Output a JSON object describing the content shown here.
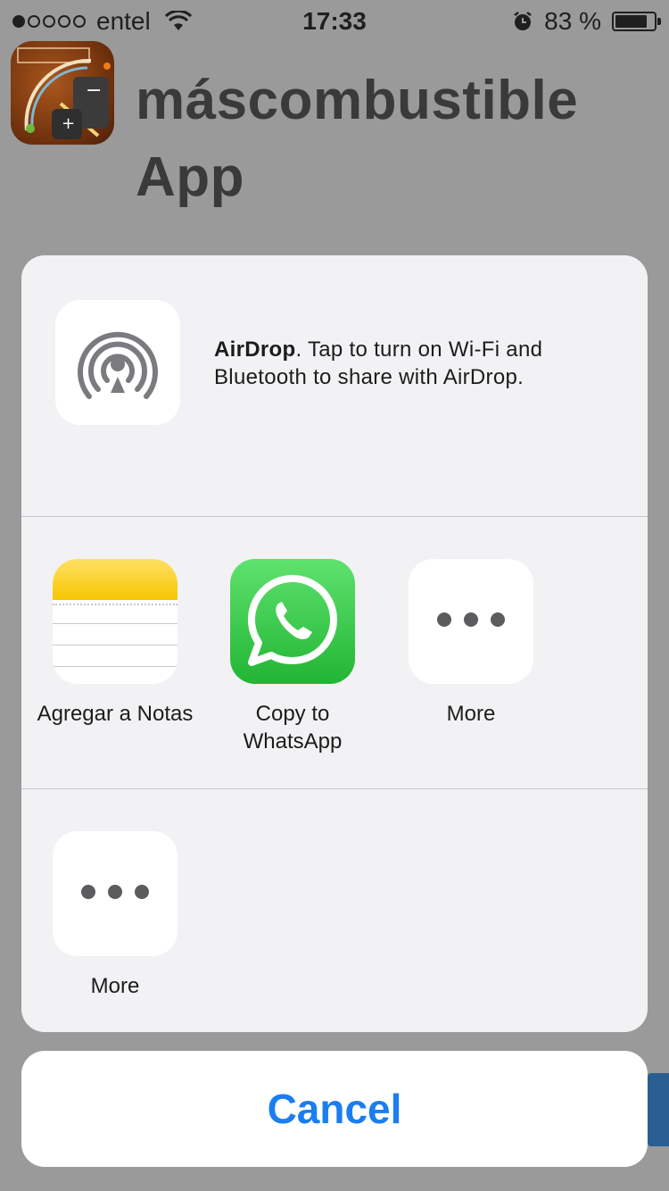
{
  "status_bar": {
    "carrier": "entel",
    "time": "17:33",
    "battery_text": "83 %",
    "battery_level": 0.83,
    "signal_bars_filled": 1,
    "signal_bars_total": 5
  },
  "background_app": {
    "title_line1": "máscombustible",
    "title_line2": "App",
    "icon": "fuel-gauge-app-icon"
  },
  "share_sheet": {
    "airdrop": {
      "bold": "AirDrop",
      "text": ". Tap to turn on Wi-Fi and Bluetooth to share with AirDrop.",
      "icon": "airdrop-icon"
    },
    "apps": [
      {
        "label": "Agregar a Notas",
        "icon": "notes-icon"
      },
      {
        "label": "Copy to WhatsApp",
        "icon": "whatsapp-icon"
      },
      {
        "label": "More",
        "icon": "more-icon"
      }
    ],
    "actions": [
      {
        "label": "More",
        "icon": "more-icon"
      }
    ]
  },
  "cancel_label": "Cancel",
  "colors": {
    "accent": "#1a7ef0",
    "whatsapp_green": "#22b534",
    "notes_yellow": "#f7c600"
  }
}
